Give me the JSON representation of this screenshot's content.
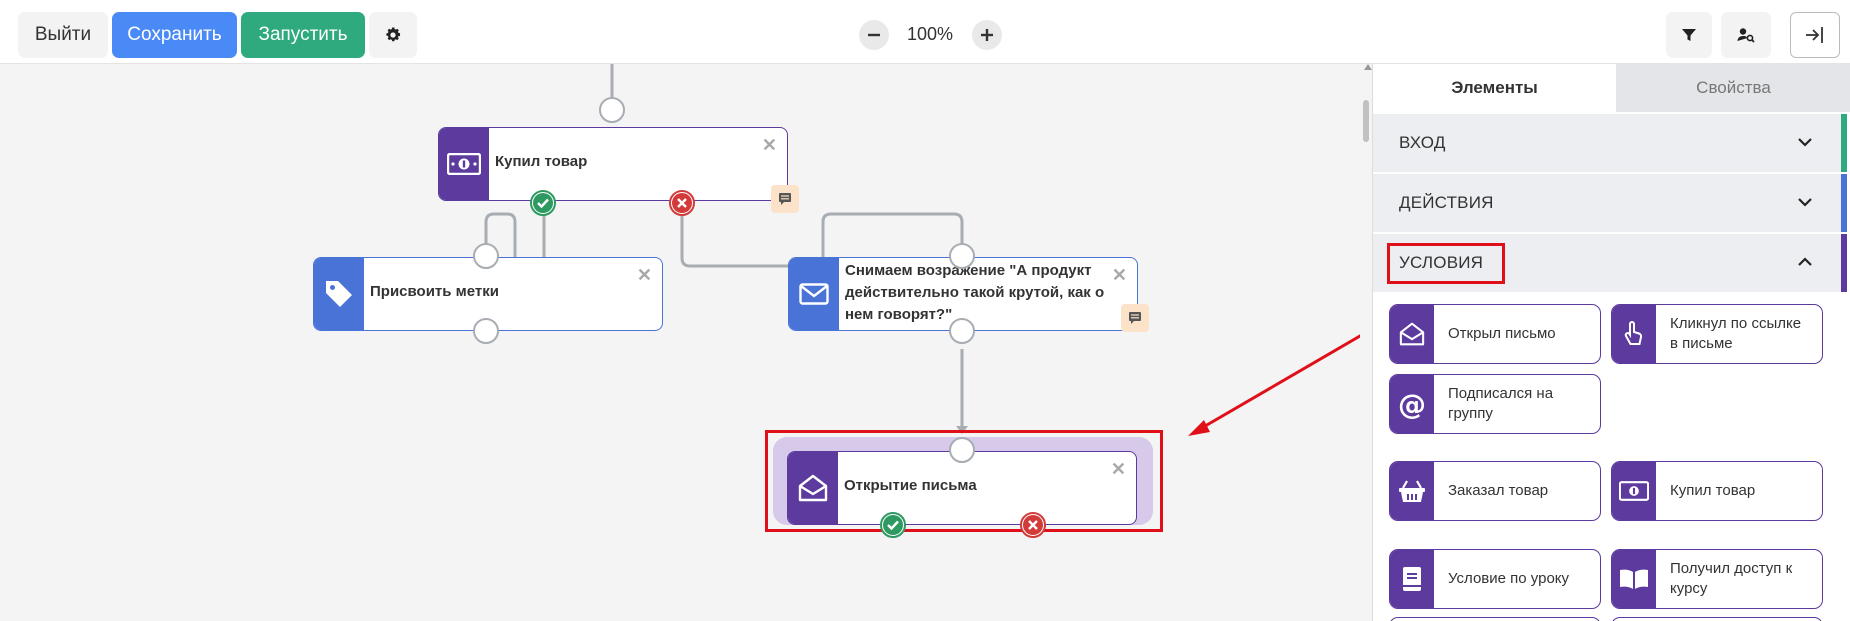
{
  "toolbar": {
    "exit_label": "Выйти",
    "save_label": "Сохранить",
    "run_label": "Запустить",
    "zoom_value": "100%"
  },
  "nodes": {
    "bought": {
      "title": "Купил товар"
    },
    "tags": {
      "title": "Присвоить метки"
    },
    "email": {
      "title": "Снимаем возражение \"А продукт действительно такой крутой, как о нем говорят?\""
    },
    "opened": {
      "title": "Открытие письма"
    }
  },
  "panel": {
    "tabs": [
      {
        "label": "Элементы",
        "active": true
      },
      {
        "label": "Свойства",
        "active": false
      }
    ],
    "sections": [
      {
        "label": "ВХОД",
        "accent": "#2eaa7e",
        "expanded": false
      },
      {
        "label": "ДЕЙСТВИЯ",
        "accent": "#4a73d8",
        "expanded": false
      },
      {
        "label": "УСЛОВИЯ",
        "accent": "#5c3a9e",
        "expanded": true
      }
    ],
    "conditions": [
      {
        "label": "Открыл письмо",
        "icon": "envelope-open-icon"
      },
      {
        "label": "Кликнул по ссылке в письме",
        "icon": "pointer-hand-icon"
      },
      {
        "label": "Подписался на группу",
        "icon": "at-sign-icon"
      },
      {
        "label": "Заказал товар",
        "icon": "basket-icon"
      },
      {
        "label": "Купил товар",
        "icon": "money-icon"
      },
      {
        "label": "Условие по уроку",
        "icon": "book-icon"
      },
      {
        "label": "Получил доступ к курсу",
        "icon": "open-book-icon"
      }
    ]
  },
  "colors": {
    "blue": "#4a8af7",
    "green": "#2eaa7e",
    "purple": "#5c3a9e",
    "action_blue": "#4a73d8",
    "highlight_red": "#e0101a"
  }
}
